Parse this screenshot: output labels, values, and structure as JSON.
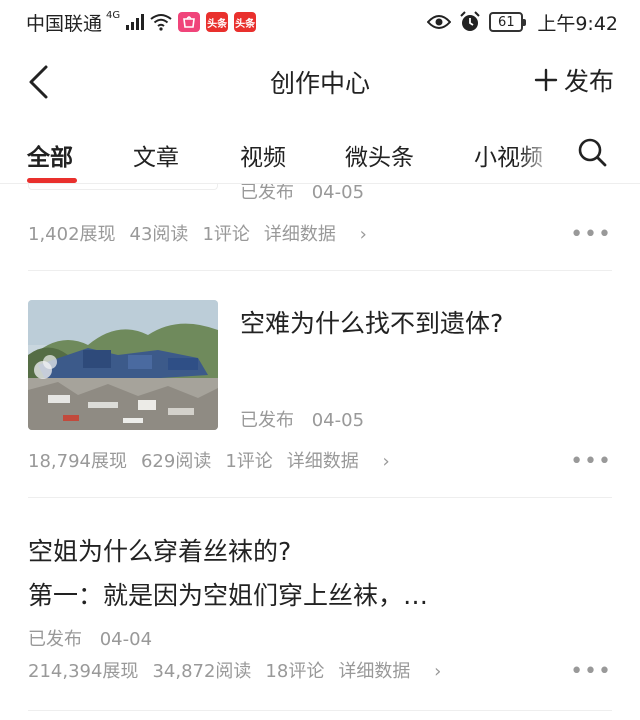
{
  "status_bar": {
    "carrier": "中国联通",
    "network_type": "4G",
    "app_badge_1": "头条",
    "app_badge_2": "头条",
    "battery": "61",
    "time": "上午9:42",
    "icons": [
      "signal-icon",
      "wifi-icon",
      "eye-icon",
      "alarm-icon",
      "battery-icon"
    ]
  },
  "header": {
    "title": "创作中心",
    "publish_label": "发布"
  },
  "tabs": [
    {
      "label": "全部",
      "active": true
    },
    {
      "label": "文章",
      "active": false
    },
    {
      "label": "视频",
      "active": false
    },
    {
      "label": "微头条",
      "active": false
    },
    {
      "label": "小视频",
      "active": false
    }
  ],
  "accent_color": "#e9302d",
  "feed": {
    "items": [
      {
        "status": "已发布",
        "date": "04-05",
        "stats": {
          "views": "1,402展现",
          "reads": "43阅读",
          "comments": "1评论"
        },
        "detail_label": "详细数据"
      },
      {
        "title": "空难为什么找不到遗体?",
        "status": "已发布",
        "date": "04-05",
        "stats": {
          "views": "18,794展现",
          "reads": "629阅读",
          "comments": "1评论"
        },
        "detail_label": "详细数据"
      },
      {
        "title_line1": "空姐为什么穿着丝袜的?",
        "title_line2": "第一：就是因为空姐们穿上丝袜，…",
        "status": "已发布",
        "date": "04-04",
        "stats": {
          "views": "214,394展现",
          "reads": "34,872阅读",
          "comments": "18评论"
        },
        "detail_label": "详细数据"
      }
    ]
  }
}
